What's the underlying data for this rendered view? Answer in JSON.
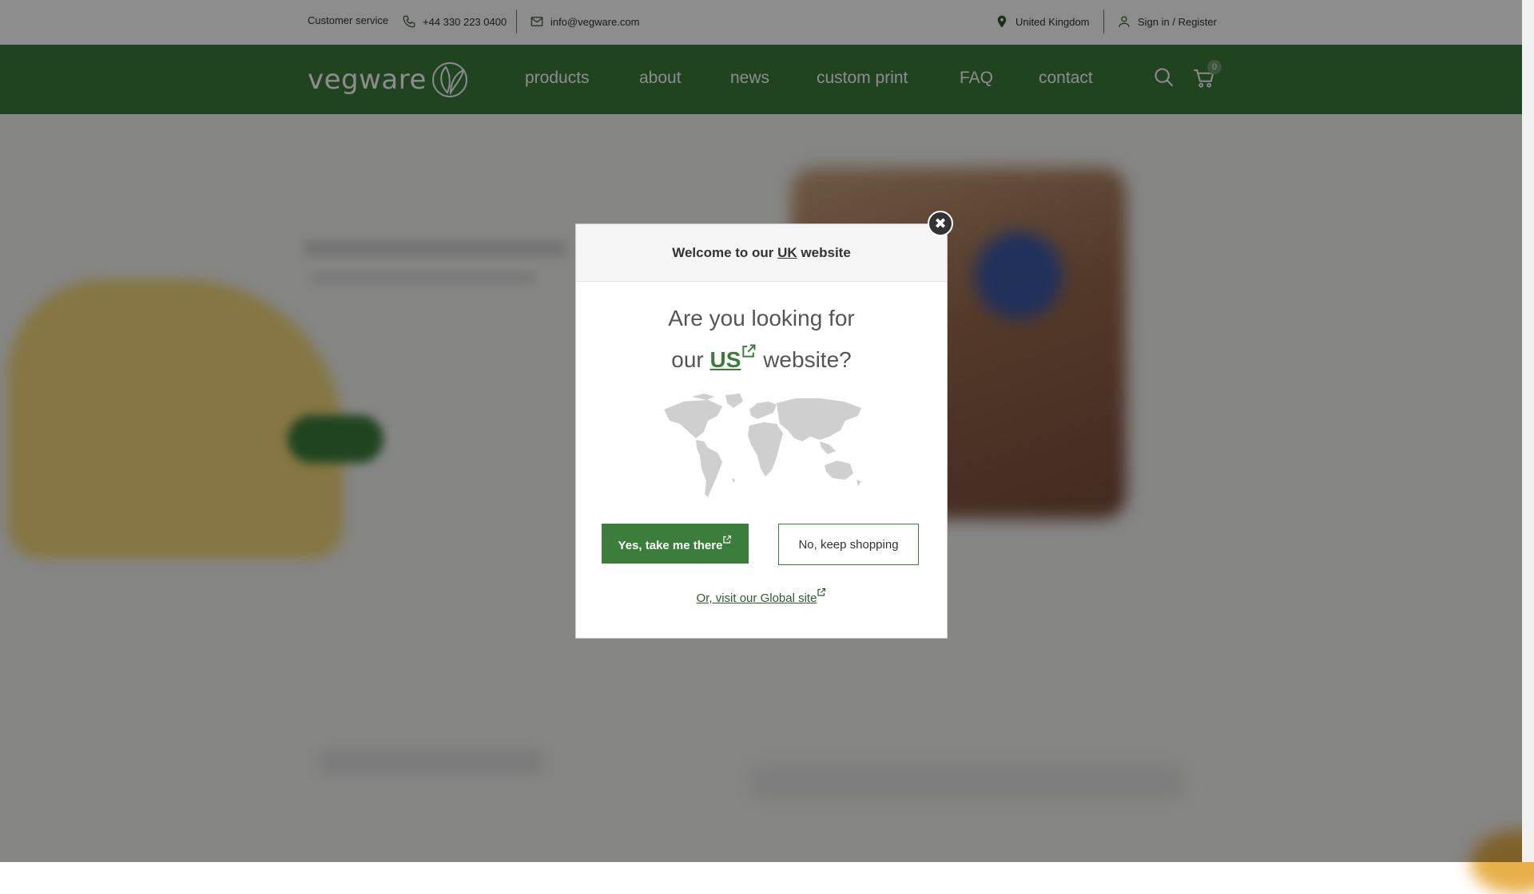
{
  "topbar": {
    "customer_service": "Customer service",
    "phone": "+44 330 223 0400",
    "email": "info@vegware.com",
    "region": "United Kingdom",
    "account": "Sign in / Register"
  },
  "nav": {
    "logo_text": "vegware",
    "links": [
      "products",
      "about",
      "news",
      "custom print",
      "FAQ",
      "contact"
    ],
    "cart_count": "0"
  },
  "modal": {
    "header_prefix": "Welcome to our ",
    "header_country": "UK",
    "header_suffix": " website",
    "question_line1": "Are you looking for",
    "question_prefix": "our ",
    "question_link": "US",
    "question_suffix": " website?",
    "yes_button": "Yes, take me there",
    "no_button": "No, keep shopping",
    "global_link": "Or, visit our Global site"
  },
  "colors": {
    "brand_green": "#3b7d3b",
    "overlay": "rgba(0,0,0,0.45)"
  },
  "icons": [
    "phone-icon",
    "mail-icon",
    "location-pin-icon",
    "user-icon",
    "search-icon",
    "cart-icon",
    "close-icon",
    "external-link-icon",
    "world-map"
  ]
}
